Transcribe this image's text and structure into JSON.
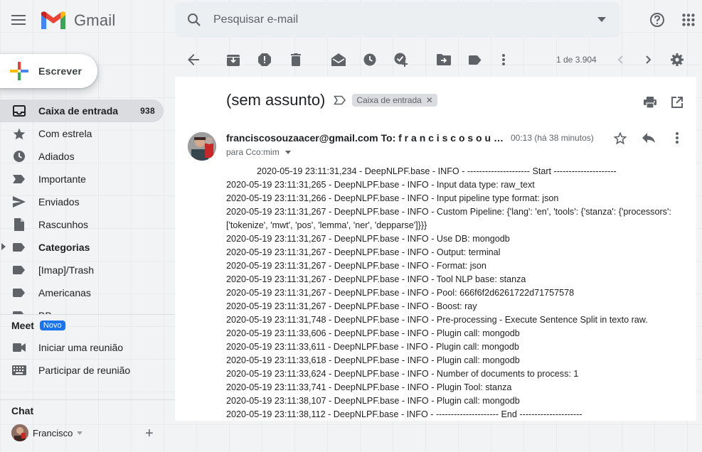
{
  "header": {
    "app_name": "Gmail",
    "search_placeholder": "Pesquisar e-mail"
  },
  "sidebar": {
    "compose_label": "Escrever",
    "items": [
      {
        "label": "Caixa de entrada",
        "count": "938",
        "icon": "inbox-icon"
      },
      {
        "label": "Com estrela",
        "icon": "star-icon"
      },
      {
        "label": "Adiados",
        "icon": "clock-icon"
      },
      {
        "label": "Importante",
        "icon": "label-important-icon"
      },
      {
        "label": "Enviados",
        "icon": "send-icon"
      },
      {
        "label": "Rascunhos",
        "icon": "draft-icon"
      },
      {
        "label": "Categorias",
        "icon": "label-icon"
      },
      {
        "label": "[Imap]/Trash",
        "icon": "label-icon"
      },
      {
        "label": "Americanas",
        "icon": "label-icon"
      },
      {
        "label": "BB",
        "icon": "label-icon"
      }
    ],
    "meet": {
      "title": "Meet",
      "badge": "Novo",
      "items": [
        {
          "label": "Iniciar uma reunião",
          "icon": "video-icon"
        },
        {
          "label": "Participar de reunião",
          "icon": "keyboard-icon"
        }
      ]
    },
    "chat": {
      "title": "Chat",
      "user": "Francisco"
    }
  },
  "toolbar": {
    "pager_text": "1 de 3.904"
  },
  "message": {
    "subject": "(sem assunto)",
    "label_chip": "Caixa de entrada",
    "sender": "franciscosouzaacer@gmail.com To: f r a n c i s c o s o u z a a c e r @ g m a i l . c o m",
    "recipient": "para Cco:mim",
    "timestamp": "00:13 (há 38 minutos)",
    "body_lines": [
      "2020-05-19 23:11:31,234 - DeepNLPF.base - INFO - --------------------- Start ---------------------",
      "2020-05-19 23:11:31,265 - DeepNLPF.base - INFO - Input data type: raw_text",
      "2020-05-19 23:11:31,266 - DeepNLPF.base - INFO - Input pipeline type format: json",
      "2020-05-19 23:11:31,267 - DeepNLPF.base - INFO - Custom Pipeline: {'lang': 'en', 'tools': {'stanza': {'processors': ['tokenize', 'mwt', 'pos', 'lemma', 'ner', 'depparse']}}}",
      "2020-05-19 23:11:31,267 - DeepNLPF.base - INFO - Use DB: mongodb",
      "2020-05-19 23:11:31,267 - DeepNLPF.base - INFO - Output: terminal",
      "2020-05-19 23:11:31,267 - DeepNLPF.base - INFO - Format: json",
      "2020-05-19 23:11:31,267 - DeepNLPF.base - INFO - Tool NLP base: stanza",
      "2020-05-19 23:11:31,267 - DeepNLPF.base - INFO - Pool: 666f6f2d6261722d71757578",
      "2020-05-19 23:11:31,267 - DeepNLPF.base - INFO - Boost: ray",
      "2020-05-19 23:11:31,748 - DeepNLPF.base - INFO - Pre-processing - Execute Sentence Split in texto raw.",
      "2020-05-19 23:11:33,606 - DeepNLPF.base - INFO - Plugin call: mongodb",
      "2020-05-19 23:11:33,611 - DeepNLPF.base - INFO - Plugin call: mongodb",
      "2020-05-19 23:11:33,618 - DeepNLPF.base - INFO - Plugin call: mongodb",
      "2020-05-19 23:11:33,624 - DeepNLPF.base - INFO - Number of documents to process: 1",
      "2020-05-19 23:11:33,741 - DeepNLPF.base - INFO - Plugin Tool: stanza",
      "2020-05-19 23:11:38,107 - DeepNLPF.base - INFO - Plugin call: mongodb",
      "2020-05-19 23:11:38,112 - DeepNLPF.base - INFO - --------------------- End ---------------------"
    ]
  }
}
